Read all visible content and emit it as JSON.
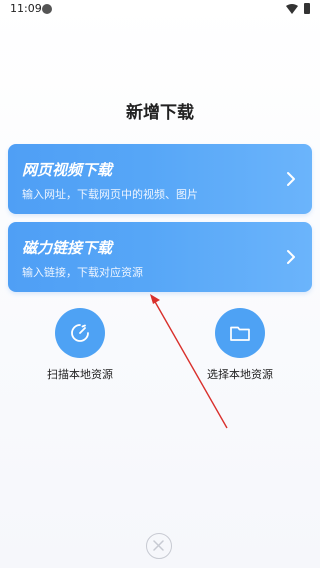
{
  "status_bar": {
    "time": "11:09"
  },
  "page": {
    "title": "新增下载"
  },
  "cards": [
    {
      "title": "网页视频下载",
      "subtitle": "输入网址，下载网页中的视频、图片"
    },
    {
      "title": "磁力链接下载",
      "subtitle": "输入链接，下载对应资源"
    }
  ],
  "actions": [
    {
      "label": "扫描本地资源",
      "icon": "scan-icon"
    },
    {
      "label": "选择本地资源",
      "icon": "folder-icon"
    }
  ],
  "colors": {
    "accent": "#4ea2f4",
    "annotation_arrow": "#d9302c"
  }
}
